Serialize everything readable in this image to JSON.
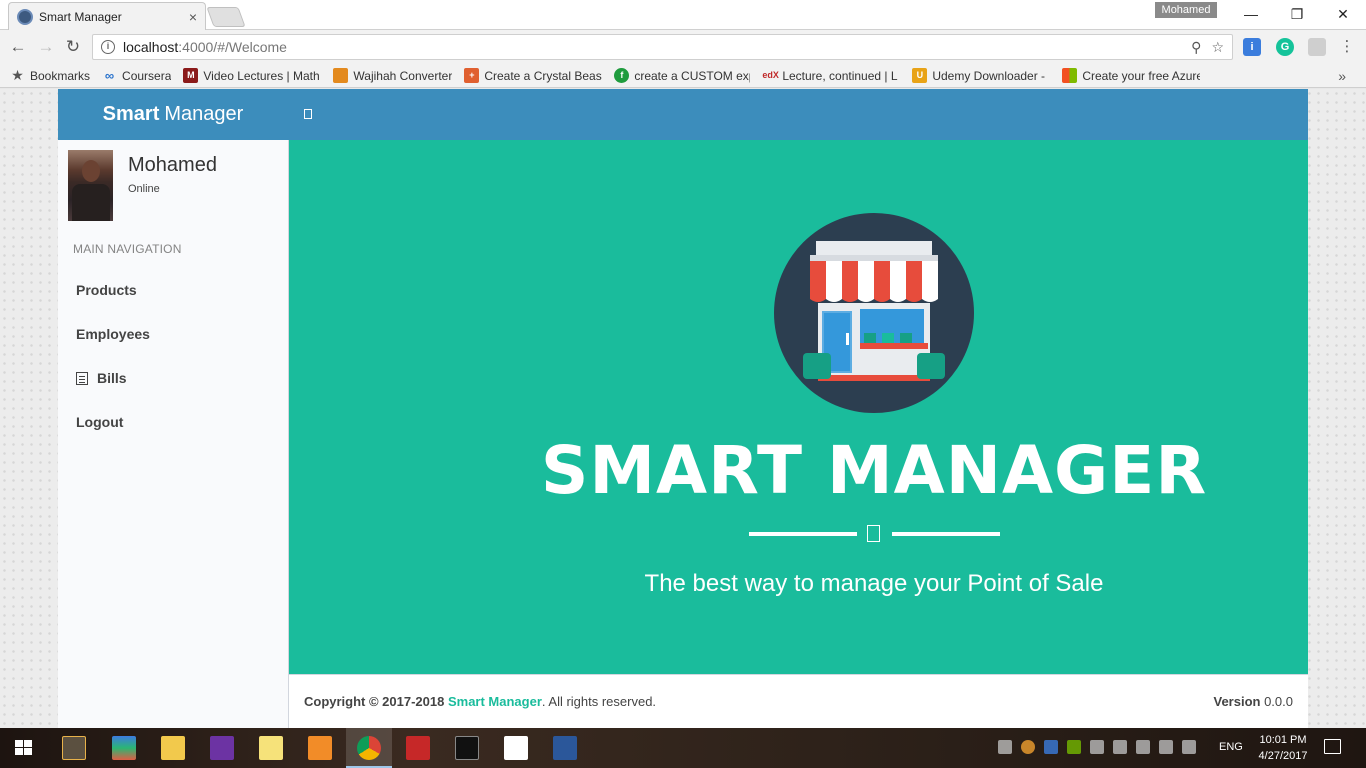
{
  "browser": {
    "tab_title": "Smart Manager",
    "tab_close": "×",
    "profile_name": "Mohamed",
    "url_host": "localhost",
    "url_path": ":4000/#/Welcome",
    "bookmarks": [
      {
        "label": "Bookmarks",
        "icon": "star-icon"
      },
      {
        "label": "Coursera",
        "icon": "coursera-icon"
      },
      {
        "label": "Video Lectures | Math",
        "icon": "mit-ocw-icon"
      },
      {
        "label": "Wajihah Converter",
        "icon": "wajihah-icon"
      },
      {
        "label": "Create a Crystal Beast",
        "icon": "crystal-icon"
      },
      {
        "label": "create a CUSTOM exp",
        "icon": "custom-icon"
      },
      {
        "label": "Lecture, continued | L",
        "icon": "edx-icon"
      },
      {
        "label": "Udemy Downloader -",
        "icon": "udemy-icon"
      },
      {
        "label": "Create your free Azure",
        "icon": "microsoft-icon"
      }
    ],
    "bookmarks_more": "»"
  },
  "app": {
    "logo_bold": "Smart",
    "logo_rest": "Manager",
    "user": {
      "name": "Mohamed",
      "status": "Online"
    },
    "nav_header": "MAIN NAVIGATION",
    "nav_items": [
      {
        "label": "Products"
      },
      {
        "label": "Employees"
      },
      {
        "label": "Bills"
      },
      {
        "label": "Logout"
      }
    ],
    "hero": {
      "title": "SMART MANAGER",
      "subtitle": "The best way to manage your Point of Sale"
    },
    "footer": {
      "copyright_prefix": "Copyright © 2017-2018 ",
      "brand": "Smart Manager",
      "copyright_suffix": ". All rights reserved.",
      "version_label": "Version",
      "version_number": "0.0.0"
    },
    "colors": {
      "header": "#3c8dbc",
      "hero": "#1abc9c",
      "sidebar": "#f9fafc"
    }
  },
  "taskbar": {
    "language": "ENG",
    "time": "10:01 PM",
    "date": "4/27/2017"
  }
}
